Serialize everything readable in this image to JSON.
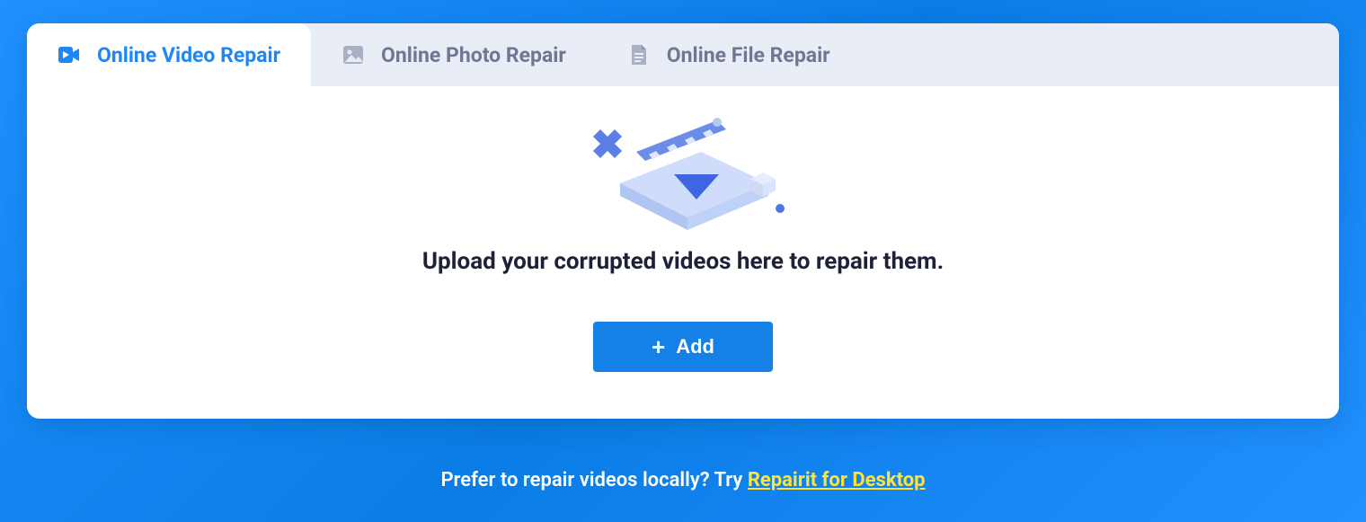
{
  "tabs": [
    {
      "label": "Online Video Repair"
    },
    {
      "label": "Online Photo Repair"
    },
    {
      "label": "Online File Repair"
    }
  ],
  "main": {
    "message": "Upload your corrupted videos here to repair them.",
    "add_label": "Add"
  },
  "footer": {
    "prefix": "Prefer to repair videos locally? Try ",
    "link": "Repairit for Desktop"
  }
}
